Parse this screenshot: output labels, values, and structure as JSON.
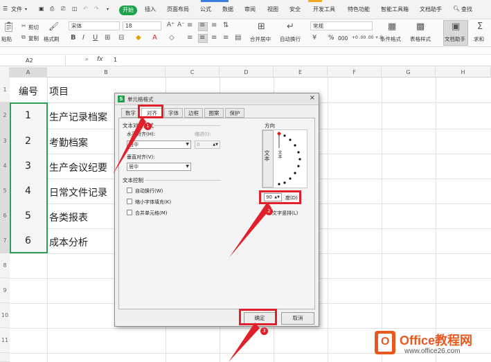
{
  "menu": {
    "file": "文件",
    "start": "开始",
    "items": [
      "插入",
      "页面布局",
      "公式",
      "数据",
      "审阅",
      "视图",
      "安全",
      "开发工具",
      "特色功能",
      "智能工具箱",
      "文档助手"
    ],
    "search": "查找"
  },
  "ribbon": {
    "cut": "剪切",
    "copy": "复制",
    "paste": "粘贴",
    "format_painter": "格式刷",
    "font_name": "宋体",
    "font_size": "18",
    "merge_center": "合并居中",
    "wrap_text": "自动换行",
    "number_format": "常规",
    "percent": "%",
    "thousands": "000",
    "dec_inc": "+0 .00",
    "dec_dec": ".00 +.0",
    "conditional_format": "条件格式",
    "table_style": "表格样式",
    "doc_assistant": "文档助手",
    "sum": "求和"
  },
  "formula_bar": {
    "name_box": "A2",
    "fx": "fx",
    "value": "1"
  },
  "sheet": {
    "columns": [
      "A",
      "B",
      "C",
      "D",
      "E",
      "F",
      "G",
      "H"
    ],
    "rows": [
      "1",
      "2",
      "3",
      "4",
      "5",
      "6",
      "7",
      "8",
      "9",
      "10",
      "11"
    ],
    "header_a": "编号",
    "header_b": "项目",
    "data": [
      {
        "num": "1",
        "item": "生产记录档案"
      },
      {
        "num": "2",
        "item": "考勤档案"
      },
      {
        "num": "3",
        "item": "生产会议纪要"
      },
      {
        "num": "4",
        "item": "日常文件记录"
      },
      {
        "num": "5",
        "item": "各类报表"
      },
      {
        "num": "6",
        "item": "成本分析"
      }
    ]
  },
  "dialog": {
    "title": "单元格格式",
    "tabs": [
      "数字",
      "对齐",
      "字体",
      "边框",
      "图案",
      "保护"
    ],
    "active_tab": "对齐",
    "text_align_group": "文本对齐方式",
    "horizontal_label": "水平对齐(H):",
    "horizontal_value": "居中",
    "indent_label": "缩进(I):",
    "indent_value": "0",
    "vertical_label": "垂直对齐(V):",
    "vertical_value": "居中",
    "text_control_group": "文本控制",
    "wrap_text": "自动换行(W)",
    "shrink_fit": "缩小字体填充(K)",
    "merge_cells": "合并单元格(M)",
    "orientation_group": "方向",
    "vertical_text": "文本",
    "orient_text": "文本",
    "degree_value": "90",
    "degree_label": "度(D)",
    "text_vertical_label": "文字竖排(L)",
    "ok": "确定",
    "cancel": "取消"
  },
  "annotations": {
    "badge_1": "1",
    "badge_2": "2",
    "badge_3": "3"
  },
  "watermark": {
    "brand": "Office教程网",
    "url": "www.office26.com"
  },
  "colors": {
    "accent_green": "#1aa34a",
    "highlight_red": "#e0202a",
    "logo_orange": "#e8591f"
  }
}
